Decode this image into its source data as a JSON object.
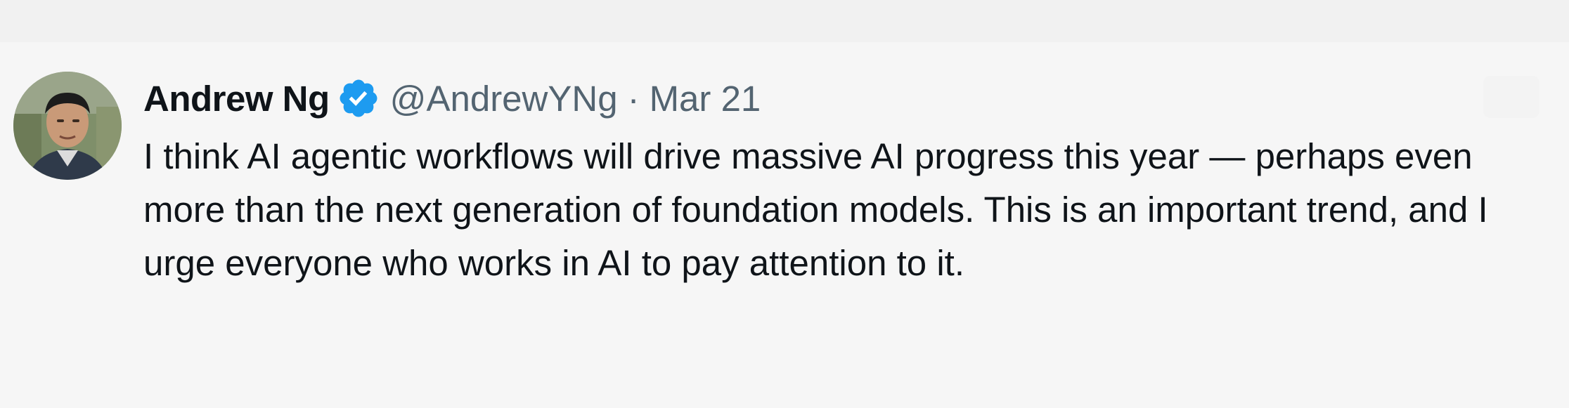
{
  "tweet": {
    "author": {
      "display_name": "Andrew Ng",
      "handle": "@AndrewYNg",
      "verified_icon": "verified-badge-icon",
      "avatar_icon": "avatar"
    },
    "separator": "·",
    "date": "Mar 21",
    "text": "I think AI agentic workflows will drive massive AI progress this year — perhaps even more than the next generation of foundation models. This is an important trend, and I urge everyone who works in AI to pay attention to it."
  },
  "colors": {
    "background": "#f6f6f6",
    "primary_text": "#0f1419",
    "secondary_text": "#536471",
    "verified_blue": "#1d9bf0"
  }
}
